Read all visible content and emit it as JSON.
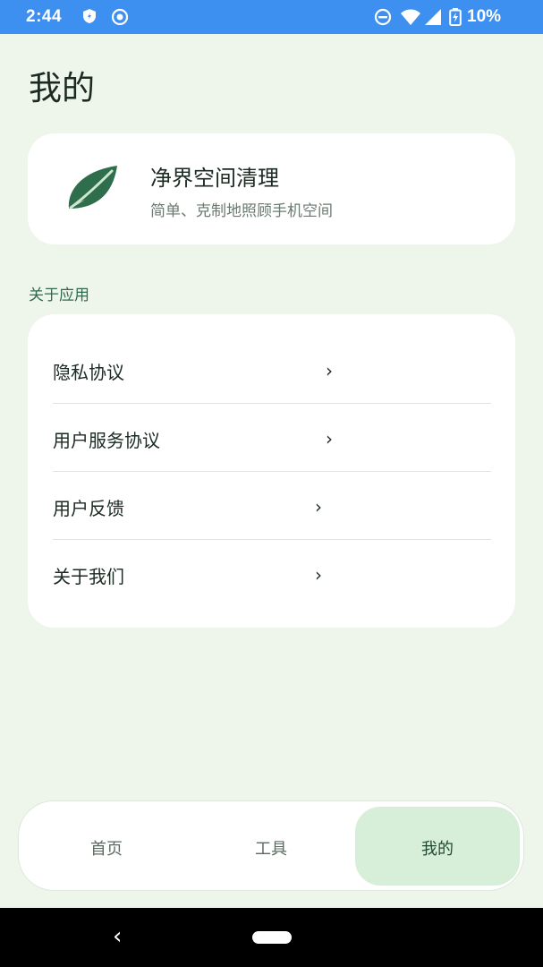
{
  "status_bar": {
    "time": "2:44",
    "battery": "10%",
    "icons": [
      "shield-icon",
      "record-icon",
      "do-not-disturb-icon",
      "wifi-icon",
      "signal-icon",
      "battery-charging-icon"
    ]
  },
  "page": {
    "title": "我的"
  },
  "app_card": {
    "icon": "leaf-icon",
    "name": "净界空间清理",
    "tagline": "简单、克制地照顾手机空间"
  },
  "section": {
    "label": "关于应用"
  },
  "menu": {
    "items": [
      {
        "label": "隐私协议",
        "chevron": "›"
      },
      {
        "label": "用户服务协议",
        "chevron": "›"
      },
      {
        "label": "用户反馈",
        "chevron": "›"
      },
      {
        "label": "关于我们",
        "chevron": "›"
      }
    ]
  },
  "bottom_nav": {
    "items": [
      {
        "label": "首页",
        "active": false
      },
      {
        "label": "工具",
        "active": false
      },
      {
        "label": "我的",
        "active": true
      }
    ]
  },
  "colors": {
    "status_bar": "#3d8ff0",
    "background": "#eef6ec",
    "accent": "#2e6a4c",
    "active_tab": "#d7eed8",
    "leaf": "#2f6e4c"
  }
}
